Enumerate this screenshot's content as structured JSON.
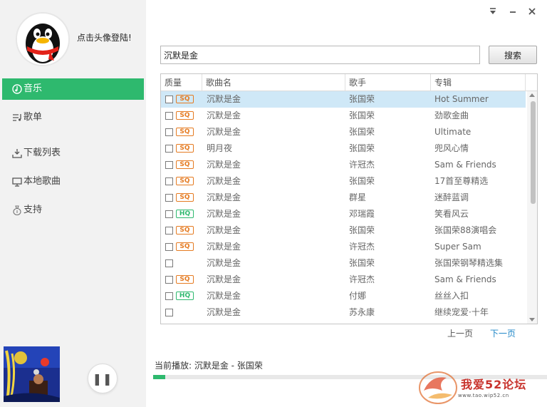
{
  "window": {
    "controls": [
      "▼",
      "—",
      "✕"
    ]
  },
  "sidebar": {
    "login_text": "点击头像登陆!",
    "nav": [
      {
        "label": "音乐",
        "icon": "music-disc-icon",
        "active": true
      },
      {
        "label": "歌单",
        "icon": "playlist-icon",
        "active": false
      },
      {
        "label": "下载列表",
        "icon": "download-icon",
        "active": false
      },
      {
        "label": "本地歌曲",
        "icon": "monitor-icon",
        "active": false
      },
      {
        "label": "支持",
        "icon": "money-bag-icon",
        "active": false
      }
    ]
  },
  "search": {
    "value": "沉默是金",
    "button_label": "搜索"
  },
  "table": {
    "headers": [
      "质量",
      "歌曲名",
      "歌手",
      "专辑"
    ],
    "rows": [
      {
        "quality": "SQ",
        "title": "沉默是金",
        "artist": "张国荣",
        "album": "Hot Summer",
        "selected": true
      },
      {
        "quality": "SQ",
        "title": "沉默是金",
        "artist": "张国荣",
        "album": "劲歌金曲"
      },
      {
        "quality": "SQ",
        "title": "沉默是金",
        "artist": "张国荣",
        "album": "Ultimate"
      },
      {
        "quality": "SQ",
        "title": "明月夜",
        "artist": "张国荣",
        "album": "兜风心情"
      },
      {
        "quality": "SQ",
        "title": "沉默是金",
        "artist": "许冠杰",
        "album": "Sam & Friends"
      },
      {
        "quality": "SQ",
        "title": "沉默是金",
        "artist": "张国荣",
        "album": "17首至尊精选"
      },
      {
        "quality": "SQ",
        "title": "沉默是金",
        "artist": "群星",
        "album": "迷醉蓝调"
      },
      {
        "quality": "HQ",
        "title": "沉默是金",
        "artist": "邓瑞霞",
        "album": "笑看风云"
      },
      {
        "quality": "SQ",
        "title": "沉默是金",
        "artist": "张国荣",
        "album": "张国荣88演唱会"
      },
      {
        "quality": "SQ",
        "title": "沉默是金",
        "artist": "许冠杰",
        "album": "Super Sam"
      },
      {
        "quality": "",
        "title": "沉默是金",
        "artist": "张国荣",
        "album": "张国荣钢琴精选集"
      },
      {
        "quality": "SQ",
        "title": "沉默是金",
        "artist": "许冠杰",
        "album": "Sam & Friends"
      },
      {
        "quality": "HQ",
        "title": "沉默是金",
        "artist": "付娜",
        "album": "丝丝入扣"
      },
      {
        "quality": "",
        "title": "沉默是金",
        "artist": "苏永康",
        "album": "继续宠爱·十年"
      }
    ]
  },
  "pager": {
    "prev": "上一页",
    "next": "下一页"
  },
  "player": {
    "now_playing": "当前播放: 沉默是金 - 张国荣",
    "progress": 0.03,
    "pause_glyph": "❚❚"
  },
  "watermark": {
    "text": "我爱52论坛",
    "url": "www.tao.wip52.cn"
  },
  "colors": {
    "accent": "#2eb96e",
    "sq": "#e57b22",
    "selected_row": "#cfe8f7",
    "link": "#1f86c7"
  }
}
